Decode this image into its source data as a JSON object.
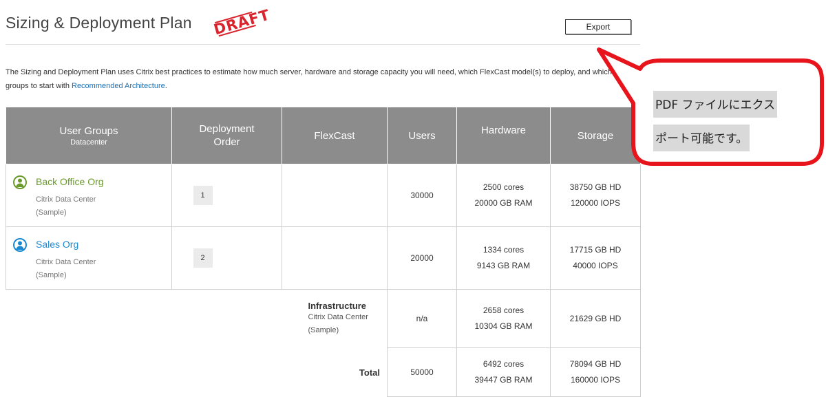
{
  "header": {
    "title": "Sizing & Deployment Plan",
    "stamp": "DRAFT",
    "export_label": "Export"
  },
  "intro": {
    "text": "The Sizing and Deployment Plan uses Citrix best practices to estimate how much server, hardware and storage capacity you will need, which FlexCast model(s) to deploy, and which user groups to start with",
    "link": "Recommended Architecture",
    "suffix": "."
  },
  "table": {
    "headers": {
      "user_groups": "User Groups",
      "user_groups_sub": "Datacenter",
      "deployment_order": "Deployment Order",
      "flexcast": "FlexCast",
      "users": "Users",
      "hardware": "Hardware",
      "storage": "Storage"
    },
    "rows": [
      {
        "name": "Back Office Org",
        "datacenter": "Citrix Data Center",
        "sample": "(Sample)",
        "order": "1",
        "flexcast": "",
        "users": "30000",
        "cores": "2500 cores",
        "ram": "20000 GB RAM",
        "hd": "38750 GB HD",
        "iops": "120000 IOPS",
        "accent": "#6a9a2b"
      },
      {
        "name": "Sales Org",
        "datacenter": "Citrix Data Center",
        "sample": "(Sample)",
        "order": "2",
        "flexcast": "",
        "users": "20000",
        "cores": "1334 cores",
        "ram": "9143 GB RAM",
        "hd": "17715 GB HD",
        "iops": "40000 IOPS",
        "accent": "#1a8ad0"
      }
    ],
    "infrastructure": {
      "label": "Infrastructure",
      "datacenter": "Citrix Data Center",
      "sample": "(Sample)",
      "users": "n/a",
      "cores": "2658 cores",
      "ram": "10304 GB RAM",
      "hd": "21629 GB HD"
    },
    "total": {
      "label": "Total",
      "users": "50000",
      "cores": "6492 cores",
      "ram": "39447 GB RAM",
      "hd": "78094 GB HD",
      "iops": "160000 IOPS"
    }
  },
  "callout": {
    "line1": "PDF ファイルにエクス",
    "line2": "ポート可能です。",
    "border_color": "#e8141c"
  },
  "icons": {
    "user_icon": "user-avatar-icon"
  },
  "colors": {
    "header_bg": "#8c8c8c",
    "link": "#1a6fb3",
    "stamp": "#d9232d"
  }
}
